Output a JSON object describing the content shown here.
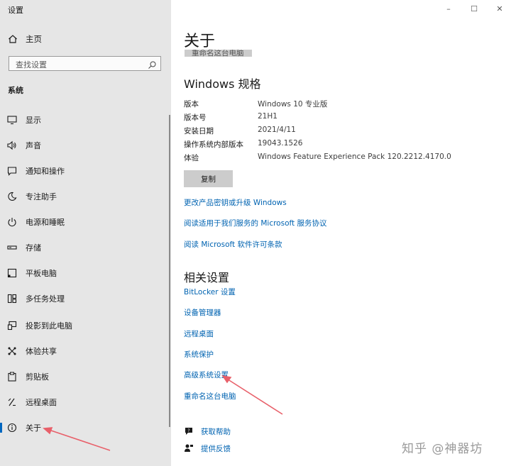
{
  "window": {
    "title": "设置",
    "controls": [
      "–",
      "☐",
      "✕"
    ]
  },
  "sidebar": {
    "home_label": "主页",
    "search_placeholder": "查找设置",
    "section_label": "系统",
    "items": [
      {
        "label": "显示",
        "icon": "display-icon"
      },
      {
        "label": "声音",
        "icon": "speaker-icon"
      },
      {
        "label": "通知和操作",
        "icon": "notification-icon"
      },
      {
        "label": "专注助手",
        "icon": "moon-icon"
      },
      {
        "label": "电源和睡眠",
        "icon": "power-icon"
      },
      {
        "label": "存储",
        "icon": "storage-icon"
      },
      {
        "label": "平板电脑",
        "icon": "tablet-icon"
      },
      {
        "label": "多任务处理",
        "icon": "multitask-icon"
      },
      {
        "label": "投影到此电脑",
        "icon": "project-icon"
      },
      {
        "label": "体验共享",
        "icon": "share-icon"
      },
      {
        "label": "剪贴板",
        "icon": "clipboard-icon"
      },
      {
        "label": "远程桌面",
        "icon": "remote-desktop-icon"
      },
      {
        "label": "关于",
        "icon": "info-icon",
        "active": true
      }
    ]
  },
  "main": {
    "title": "关于",
    "clipped_button": "重命名这台电脑",
    "spec_heading": "Windows 规格",
    "specs": [
      {
        "label": "版本",
        "value": "Windows 10 专业版"
      },
      {
        "label": "版本号",
        "value": "21H1"
      },
      {
        "label": "安装日期",
        "value": "2021/4/11"
      },
      {
        "label": "操作系统内部版本",
        "value": "19043.1526"
      },
      {
        "label": "体验",
        "value": "Windows Feature Experience Pack 120.2212.4170.0"
      }
    ],
    "copy_label": "复制",
    "links": [
      "更改产品密钥或升级 Windows",
      "阅读适用于我们服务的 Microsoft 服务协议",
      "阅读 Microsoft 软件许可条款"
    ],
    "related_heading": "相关设置",
    "related_links": [
      "BitLocker 设置",
      "设备管理器",
      "远程桌面",
      "系统保护",
      "高级系统设置",
      "重命名这台电脑"
    ],
    "help": [
      {
        "label": "获取帮助",
        "icon": "help-chat-icon"
      },
      {
        "label": "提供反馈",
        "icon": "feedback-icon"
      }
    ]
  },
  "watermark": "知乎 @神器坊",
  "colors": {
    "accent": "#0063b1",
    "sidebar_bg": "#e6e6e6",
    "arrow": "#e8606a"
  }
}
